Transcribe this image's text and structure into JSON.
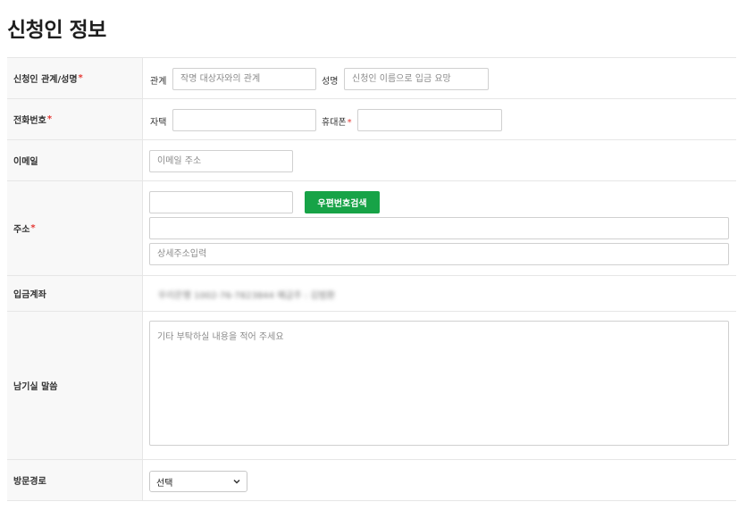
{
  "page": {
    "title": "신청인 정보"
  },
  "rows": {
    "applicant": {
      "label": "신청인 관계/성명",
      "required_mark": "*",
      "relation_label": "관계",
      "relation_placeholder": "작명 대상자와의 관계",
      "name_label": "성명",
      "name_placeholder": "신청인 이름으로 입금 요망"
    },
    "phone": {
      "label": "전화번호",
      "required_mark": "*",
      "home_label": "자택",
      "mobile_label": "휴대폰",
      "mobile_required_mark": "*"
    },
    "email": {
      "label": "이메일",
      "placeholder": "이메일 주소"
    },
    "address": {
      "label": "주소",
      "required_mark": "*",
      "zip_button_label": "우편번호검색",
      "detail_placeholder": "상세주소입력"
    },
    "account": {
      "label": "입금계좌",
      "value": "우리은행 1002-76-7823844 예금주 : 김범환"
    },
    "message": {
      "label": "남기실 말씀",
      "placeholder": "기타 부탁하실 내용을 적어 주세요"
    },
    "visit": {
      "label": "방문경로",
      "selected": "선택"
    }
  },
  "colors": {
    "accent_green": "#17a347",
    "required_red": "#e53935",
    "label_bg": "#f8f8f8",
    "border": "#e6e6e6"
  },
  "icons": {
    "select_arrow": "chevron-down-icon"
  }
}
